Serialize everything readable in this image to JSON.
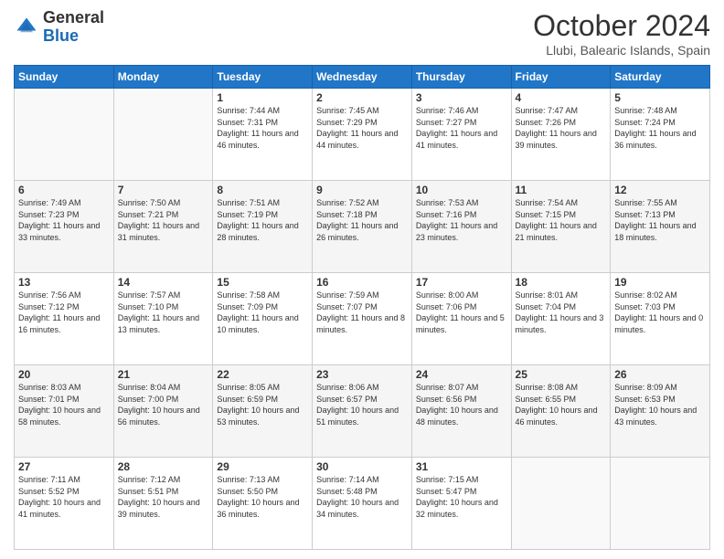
{
  "header": {
    "logo_general": "General",
    "logo_blue": "Blue",
    "month_title": "October 2024",
    "subtitle": "Llubi, Balearic Islands, Spain"
  },
  "days_of_week": [
    "Sunday",
    "Monday",
    "Tuesday",
    "Wednesday",
    "Thursday",
    "Friday",
    "Saturday"
  ],
  "weeks": [
    [
      {
        "day": "",
        "info": ""
      },
      {
        "day": "",
        "info": ""
      },
      {
        "day": "1",
        "info": "Sunrise: 7:44 AM\nSunset: 7:31 PM\nDaylight: 11 hours and 46 minutes."
      },
      {
        "day": "2",
        "info": "Sunrise: 7:45 AM\nSunset: 7:29 PM\nDaylight: 11 hours and 44 minutes."
      },
      {
        "day": "3",
        "info": "Sunrise: 7:46 AM\nSunset: 7:27 PM\nDaylight: 11 hours and 41 minutes."
      },
      {
        "day": "4",
        "info": "Sunrise: 7:47 AM\nSunset: 7:26 PM\nDaylight: 11 hours and 39 minutes."
      },
      {
        "day": "5",
        "info": "Sunrise: 7:48 AM\nSunset: 7:24 PM\nDaylight: 11 hours and 36 minutes."
      }
    ],
    [
      {
        "day": "6",
        "info": "Sunrise: 7:49 AM\nSunset: 7:23 PM\nDaylight: 11 hours and 33 minutes."
      },
      {
        "day": "7",
        "info": "Sunrise: 7:50 AM\nSunset: 7:21 PM\nDaylight: 11 hours and 31 minutes."
      },
      {
        "day": "8",
        "info": "Sunrise: 7:51 AM\nSunset: 7:19 PM\nDaylight: 11 hours and 28 minutes."
      },
      {
        "day": "9",
        "info": "Sunrise: 7:52 AM\nSunset: 7:18 PM\nDaylight: 11 hours and 26 minutes."
      },
      {
        "day": "10",
        "info": "Sunrise: 7:53 AM\nSunset: 7:16 PM\nDaylight: 11 hours and 23 minutes."
      },
      {
        "day": "11",
        "info": "Sunrise: 7:54 AM\nSunset: 7:15 PM\nDaylight: 11 hours and 21 minutes."
      },
      {
        "day": "12",
        "info": "Sunrise: 7:55 AM\nSunset: 7:13 PM\nDaylight: 11 hours and 18 minutes."
      }
    ],
    [
      {
        "day": "13",
        "info": "Sunrise: 7:56 AM\nSunset: 7:12 PM\nDaylight: 11 hours and 16 minutes."
      },
      {
        "day": "14",
        "info": "Sunrise: 7:57 AM\nSunset: 7:10 PM\nDaylight: 11 hours and 13 minutes."
      },
      {
        "day": "15",
        "info": "Sunrise: 7:58 AM\nSunset: 7:09 PM\nDaylight: 11 hours and 10 minutes."
      },
      {
        "day": "16",
        "info": "Sunrise: 7:59 AM\nSunset: 7:07 PM\nDaylight: 11 hours and 8 minutes."
      },
      {
        "day": "17",
        "info": "Sunrise: 8:00 AM\nSunset: 7:06 PM\nDaylight: 11 hours and 5 minutes."
      },
      {
        "day": "18",
        "info": "Sunrise: 8:01 AM\nSunset: 7:04 PM\nDaylight: 11 hours and 3 minutes."
      },
      {
        "day": "19",
        "info": "Sunrise: 8:02 AM\nSunset: 7:03 PM\nDaylight: 11 hours and 0 minutes."
      }
    ],
    [
      {
        "day": "20",
        "info": "Sunrise: 8:03 AM\nSunset: 7:01 PM\nDaylight: 10 hours and 58 minutes."
      },
      {
        "day": "21",
        "info": "Sunrise: 8:04 AM\nSunset: 7:00 PM\nDaylight: 10 hours and 56 minutes."
      },
      {
        "day": "22",
        "info": "Sunrise: 8:05 AM\nSunset: 6:59 PM\nDaylight: 10 hours and 53 minutes."
      },
      {
        "day": "23",
        "info": "Sunrise: 8:06 AM\nSunset: 6:57 PM\nDaylight: 10 hours and 51 minutes."
      },
      {
        "day": "24",
        "info": "Sunrise: 8:07 AM\nSunset: 6:56 PM\nDaylight: 10 hours and 48 minutes."
      },
      {
        "day": "25",
        "info": "Sunrise: 8:08 AM\nSunset: 6:55 PM\nDaylight: 10 hours and 46 minutes."
      },
      {
        "day": "26",
        "info": "Sunrise: 8:09 AM\nSunset: 6:53 PM\nDaylight: 10 hours and 43 minutes."
      }
    ],
    [
      {
        "day": "27",
        "info": "Sunrise: 7:11 AM\nSunset: 5:52 PM\nDaylight: 10 hours and 41 minutes."
      },
      {
        "day": "28",
        "info": "Sunrise: 7:12 AM\nSunset: 5:51 PM\nDaylight: 10 hours and 39 minutes."
      },
      {
        "day": "29",
        "info": "Sunrise: 7:13 AM\nSunset: 5:50 PM\nDaylight: 10 hours and 36 minutes."
      },
      {
        "day": "30",
        "info": "Sunrise: 7:14 AM\nSunset: 5:48 PM\nDaylight: 10 hours and 34 minutes."
      },
      {
        "day": "31",
        "info": "Sunrise: 7:15 AM\nSunset: 5:47 PM\nDaylight: 10 hours and 32 minutes."
      },
      {
        "day": "",
        "info": ""
      },
      {
        "day": "",
        "info": ""
      }
    ]
  ]
}
